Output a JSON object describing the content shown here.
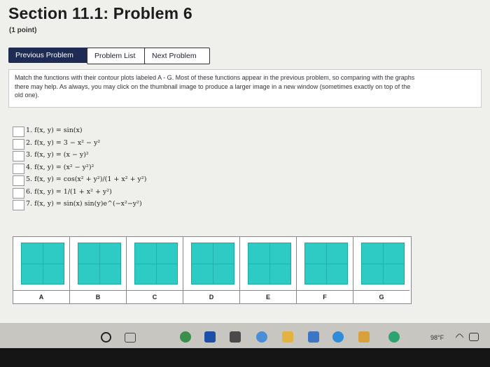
{
  "header": {
    "title": "Section 11.1: Problem 6",
    "points": "(1 point)"
  },
  "nav": {
    "previous": "Previous Problem",
    "list": "Problem List",
    "next": "Next Problem"
  },
  "intro": {
    "line1": "Match the functions with their contour plots labeled A - G. Most of these functions appear in the previous problem, so comparing with the graphs",
    "line2": "there may help. As always, you may click on the thumbnail image to produce a larger image in a new window (sometimes exactly on top of the",
    "line3": "old one)."
  },
  "questions": [
    {
      "text": "1. f(x, y) = sin(x)"
    },
    {
      "text": "2. f(x, y) = 3 − x² − y²"
    },
    {
      "text": "3. f(x, y) = (x − y)²"
    },
    {
      "text": "4. f(x, y) = (x² − y²)²"
    },
    {
      "text": "5. f(x, y) = cos(x² + y²)/(1 + x² + y²)"
    },
    {
      "text": "6. f(x, y) = 1/(1 + x² + y²)"
    },
    {
      "text": "7. f(x, y) = sin(x) sin(y)e^(−x²−y²)"
    }
  ],
  "plots": [
    {
      "label": "A"
    },
    {
      "label": "B"
    },
    {
      "label": "C"
    },
    {
      "label": "D"
    },
    {
      "label": "E"
    },
    {
      "label": "F"
    },
    {
      "label": "G"
    }
  ],
  "taskbar": {
    "temperature": "98°F",
    "accent": "#2dcbc3"
  }
}
